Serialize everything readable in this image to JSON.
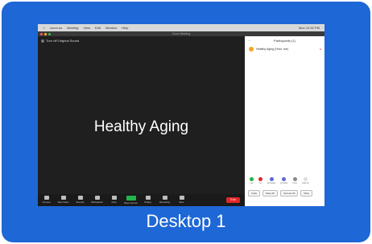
{
  "caption": "Desktop 1",
  "menubar": {
    "items": [
      "zoom.us",
      "Meeting",
      "View",
      "Edit",
      "Window",
      "Help"
    ],
    "right": "Mon 12:52 PM"
  },
  "window_title": "Zoom Meeting",
  "video": {
    "original_sound": "Turn off Original Sound",
    "participant_name": "Healthy Aging"
  },
  "toolbar": {
    "buttons": [
      "Unmute",
      "Start Video",
      "Security",
      "Participants",
      "Chat",
      "Share Screen",
      "Polling",
      "Recording",
      "More"
    ],
    "end": "End"
  },
  "panel": {
    "title": "Participants (1)",
    "participant": "Healthy Aging (Host, me)",
    "reactions": [
      "yes",
      "no",
      "go slower",
      "go faster",
      "more",
      "clear all"
    ],
    "buttons": [
      "Invite",
      "Mute All",
      "Unmute All",
      "More"
    ]
  },
  "colors": {
    "card_blue": "#1e67d6",
    "share_green": "#23b34a",
    "end_red": "#e02828",
    "avatar_orange": "#f5a623"
  }
}
